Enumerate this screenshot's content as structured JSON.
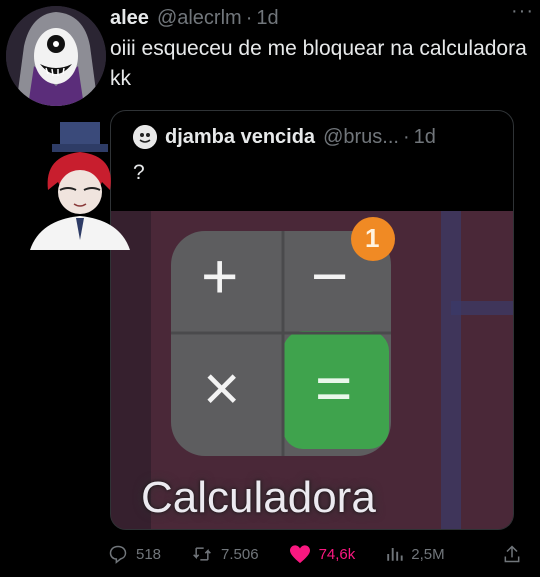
{
  "tweet": {
    "author_name": "alee",
    "author_handle": "@alecrlm",
    "separator": "·",
    "time": "1d",
    "more_glyph": "···",
    "text": "oiii esqueceu de me bloquear na calculadora kk"
  },
  "quote": {
    "author_name": "djamba vencida",
    "author_handle": "@brus...",
    "separator": "·",
    "time": "1d",
    "text": "?",
    "image": {
      "label": "Calculadora",
      "badge_count": "1",
      "plus": "+",
      "minus": "−",
      "times": "×",
      "equals": "="
    }
  },
  "actions": {
    "replies": "518",
    "reposts": "7.506",
    "likes": "74,6k",
    "views": "2,5M"
  },
  "colors": {
    "background": "#000000",
    "text": "#e7e9ea",
    "secondary": "#71767b",
    "like": "#f91880",
    "calc_green": "#3fa34d",
    "badge_orange": "#f08a24"
  }
}
